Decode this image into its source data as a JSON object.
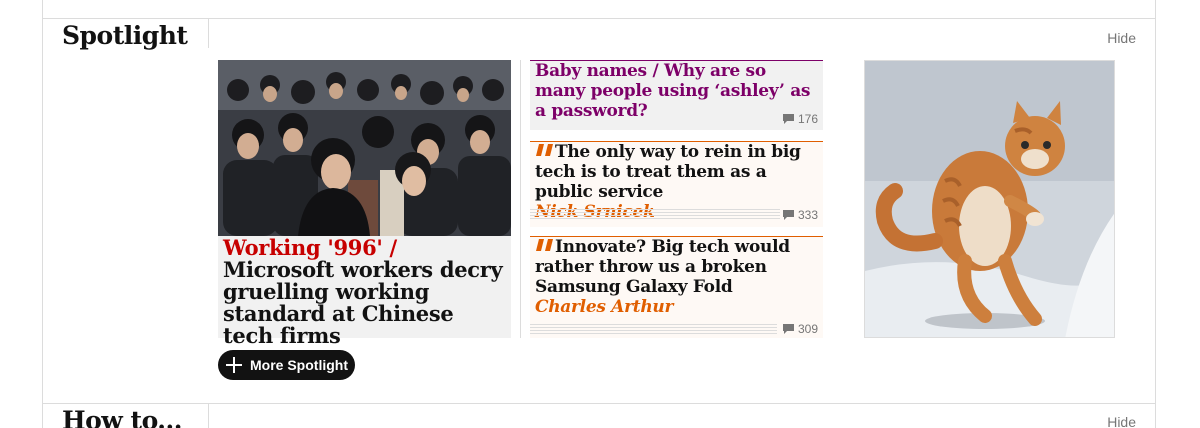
{
  "sections": [
    {
      "title": "Spotlight",
      "hide_label": "Hide"
    },
    {
      "title": "How to...",
      "hide_label": "Hide"
    }
  ],
  "spotlight": {
    "big_card": {
      "kicker": "Working '996'",
      "separator": "/",
      "headline": "Microsoft workers decry gruelling working standard at Chinese tech firms",
      "image": "crowd-of-commuters-photo"
    },
    "cards": [
      {
        "kicker": "Baby names",
        "separator": "/",
        "headline": "Why are so many people using ‘ashley’ as a password?",
        "comments": "176"
      },
      {
        "headline": "The only way to rein in big tech is to treat them as a public service",
        "byline": "Nick Srnicek",
        "comments": "333",
        "icon": "quote-icon"
      },
      {
        "headline": "Innovate? Big tech would rather throw us a broken Samsung Galaxy Fold",
        "byline": "Charles Arthur",
        "comments": "309",
        "icon": "quote-icon"
      }
    ],
    "image_card": {
      "image": "leaping-ginger-cat-photo"
    },
    "more_label": "More Spotlight"
  },
  "colors": {
    "news_red": "#c70000",
    "lifestyle_purple": "#7d0068",
    "opinion_orange": "#e05e00",
    "button_black": "#121212",
    "border_grey": "#dcdcdc"
  }
}
